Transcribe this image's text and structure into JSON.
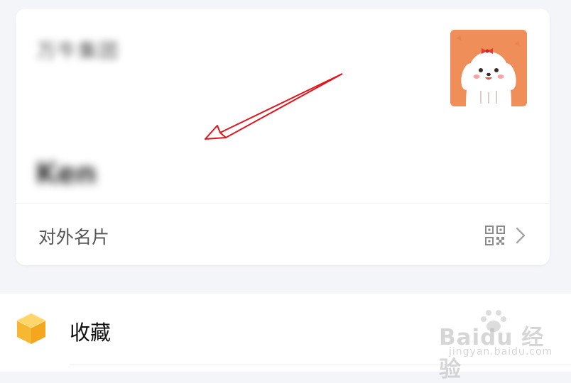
{
  "profile_card": {
    "company": "万牛集团",
    "username": "Ken",
    "business_card_label": "对外名片",
    "avatar_icon": "cartoon-dog-avatar",
    "qr_icon": "qr-code-icon",
    "chevron_icon": "chevron-right-icon"
  },
  "menu": {
    "favorites_label": "收藏",
    "favorites_icon": "cube-box-icon"
  },
  "watermark": {
    "main": "Baidu 经验",
    "sub": "jingyan.baidu.com"
  },
  "colors": {
    "page_bg": "#f4f5f8",
    "card_bg": "#ffffff",
    "avatar_bg": "#f08e5a",
    "favorites_icon": "#f7b733",
    "annotation_arrow": "#e0161e"
  }
}
